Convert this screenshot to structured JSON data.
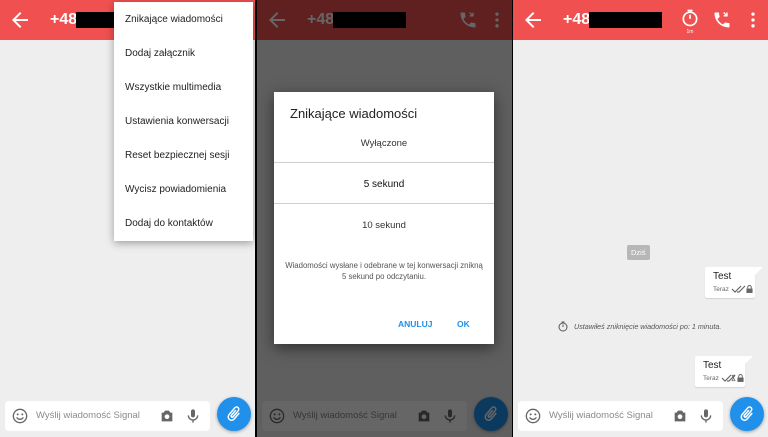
{
  "header": {
    "number_prefix": "+48",
    "timer_label": "1m"
  },
  "composer": {
    "placeholder": "Wyślij wiadomość Signal"
  },
  "menu": {
    "items": [
      {
        "label": "Znikające wiadomości"
      },
      {
        "label": "Dodaj załącznik"
      },
      {
        "label": "Wszystkie multimedia"
      },
      {
        "label": "Ustawienia konwersacji"
      },
      {
        "label": "Reset bezpiecznej sesji"
      },
      {
        "label": "Wycisz powiadomienia"
      },
      {
        "label": "Dodaj do kontaktów"
      }
    ]
  },
  "dialog": {
    "title": "Znikające wiadomości",
    "options": [
      "Wyłączone",
      "5 sekund",
      "10 sekund"
    ],
    "selected_index": 1,
    "description": "Wiadomości wysłane i odebrane w tej konwersacji znikną 5 sekund po odczytaniu.",
    "cancel_label": "ANULUJ",
    "ok_label": "OK"
  },
  "conversation": {
    "date_chip": "Dziś",
    "notice": "Ustawiłeś zniknięcie wiadomości po: 1 minuta.",
    "messages": [
      {
        "text": "Test",
        "time": "Teraz"
      },
      {
        "text": "Test",
        "time": "Teraz"
      }
    ]
  },
  "colors": {
    "toolbar": "#f05050",
    "accent": "#2090ea"
  }
}
